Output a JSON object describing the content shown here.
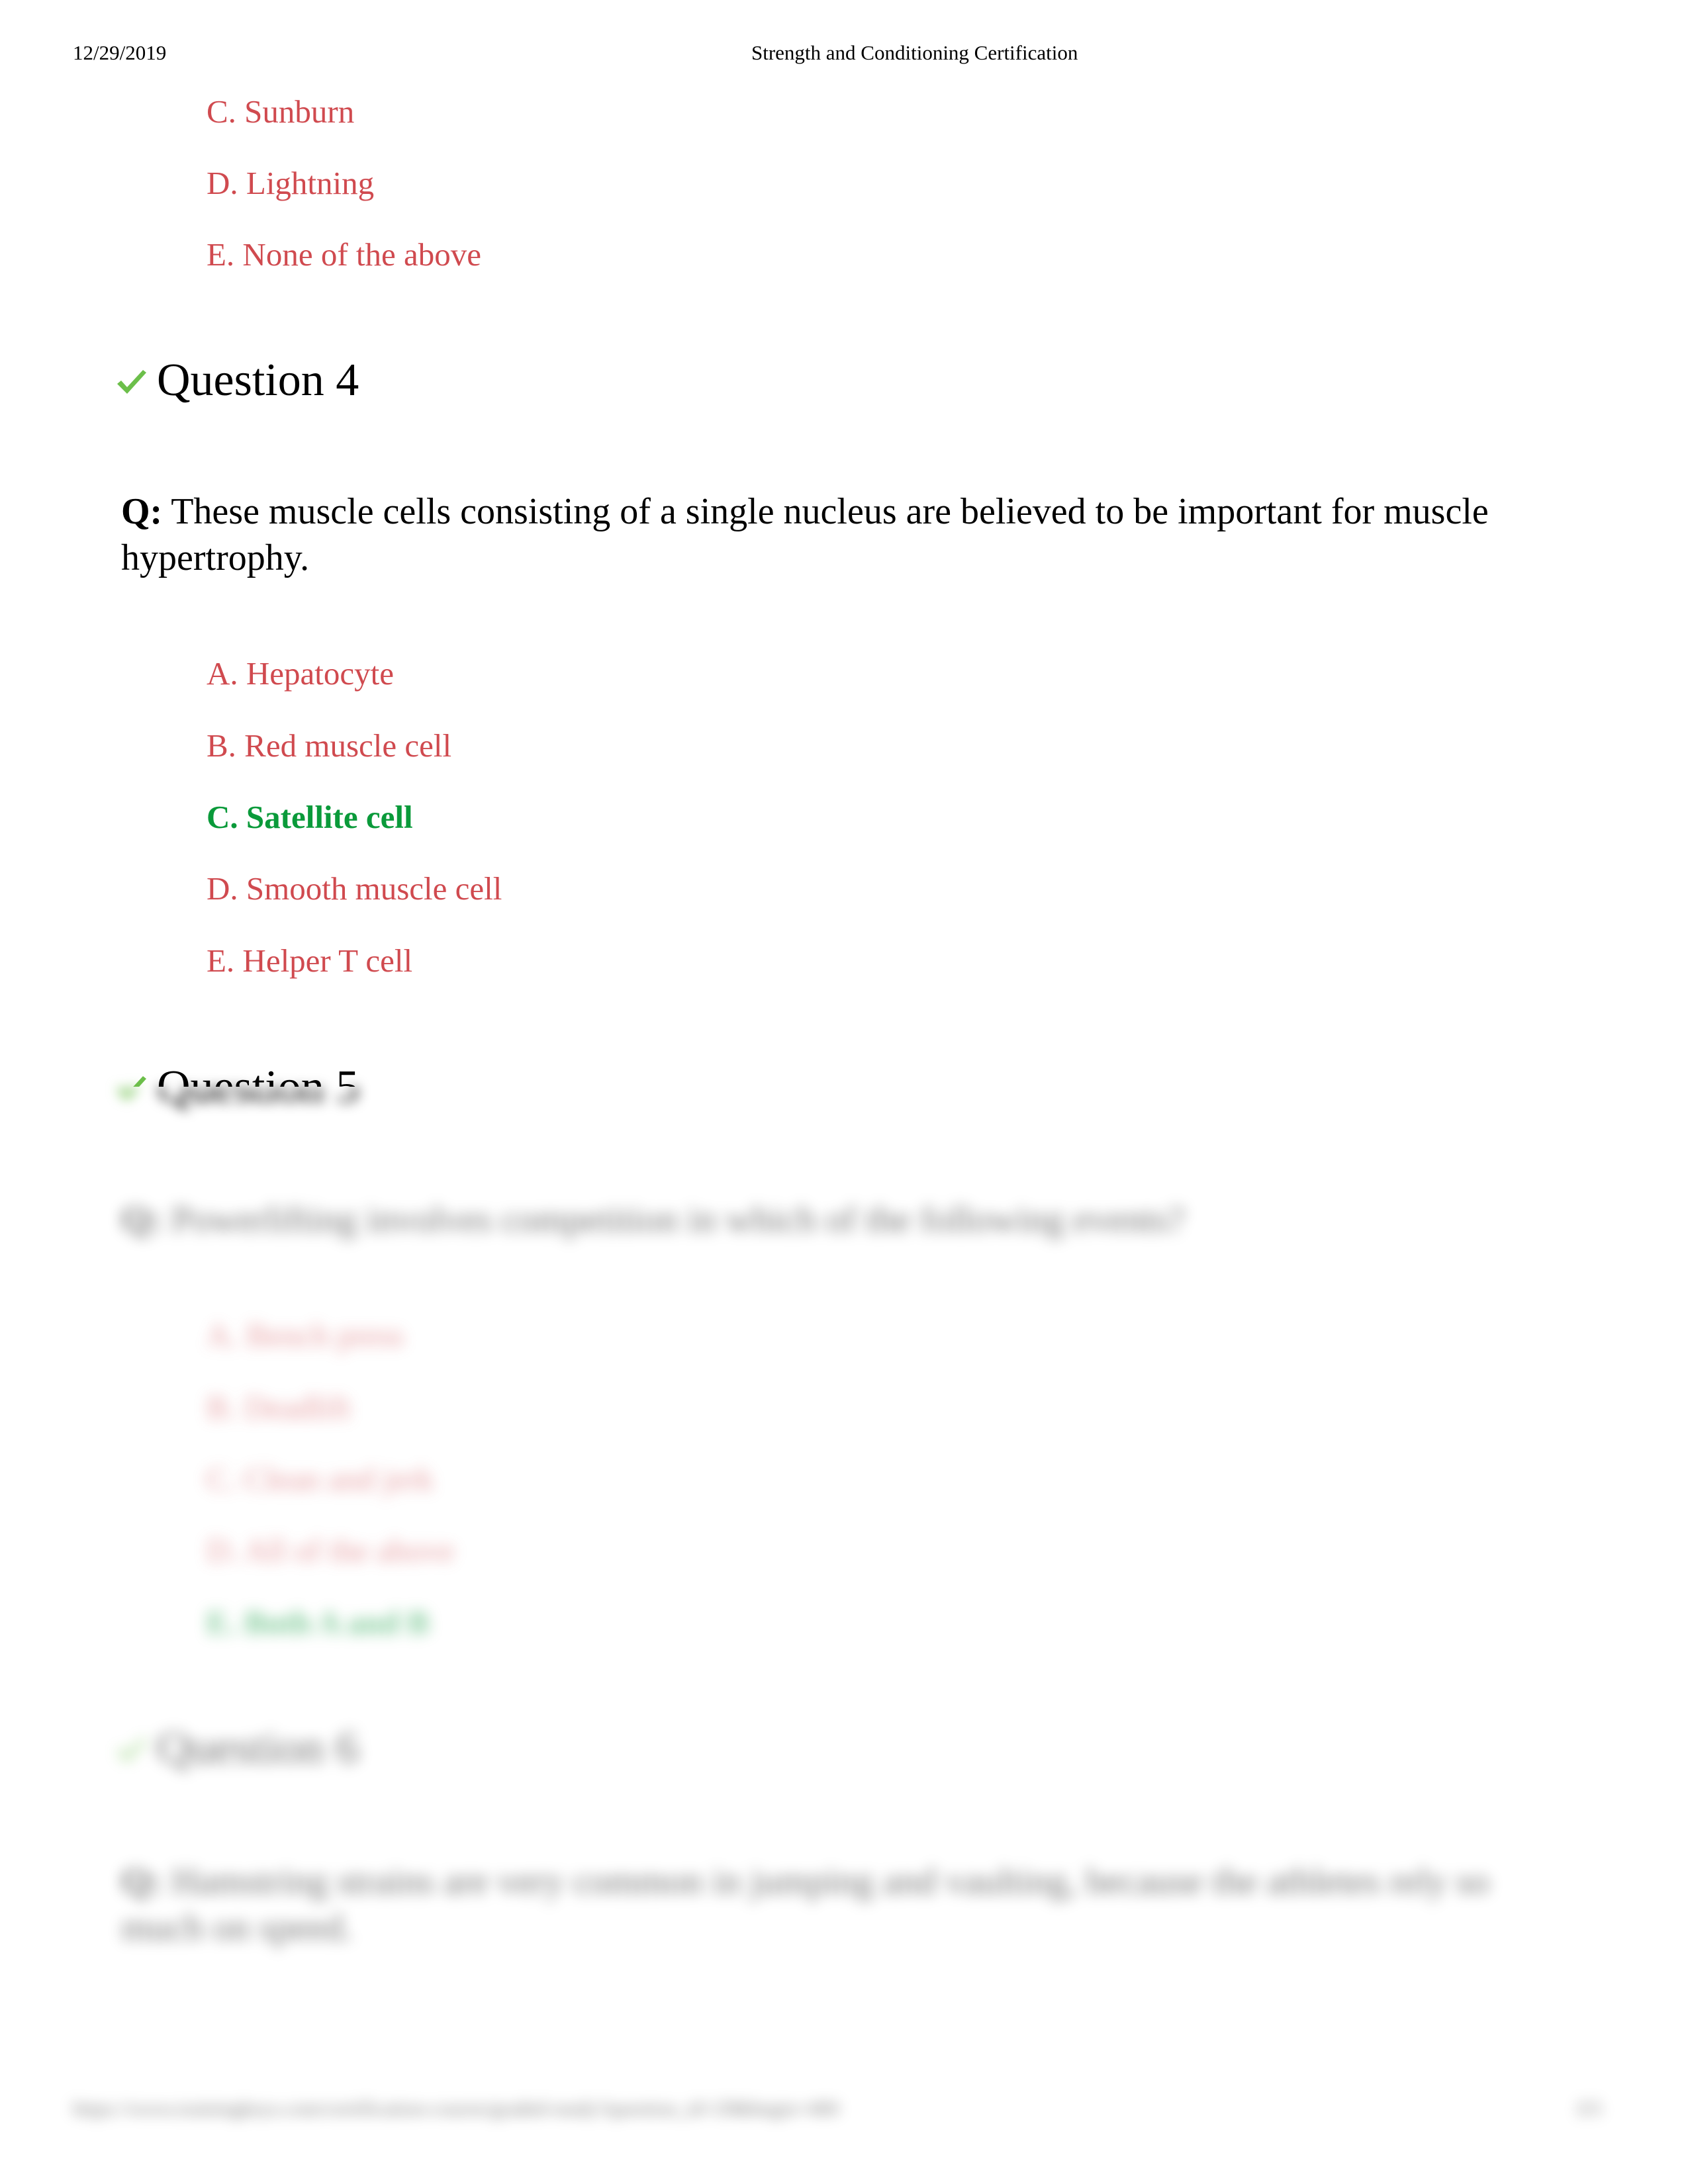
{
  "header": {
    "date": "12/29/2019",
    "title": "Strength and Conditioning Certification"
  },
  "colors": {
    "incorrect_option": "#d04a4f",
    "correct_option": "#0a9a3a",
    "check_icon": "#6cbf4a"
  },
  "question3_tail": {
    "options": [
      {
        "label": "C. Sunburn",
        "correct": false
      },
      {
        "label": "D. Lightning",
        "correct": false
      },
      {
        "label": "E. None of the above",
        "correct": false
      }
    ]
  },
  "question4": {
    "heading": "Question 4",
    "status_icon": "check-icon",
    "q_prefix": "Q:",
    "text": "These muscle cells consisting of a single nucleus are believed to be important for muscle hypertrophy.",
    "options": [
      {
        "label": "A. Hepatocyte",
        "correct": false
      },
      {
        "label": "B. Red muscle cell",
        "correct": false
      },
      {
        "label": "C. Satellite cell",
        "correct": true
      },
      {
        "label": "D. Smooth muscle cell",
        "correct": false
      },
      {
        "label": "E. Helper T cell",
        "correct": false
      }
    ]
  },
  "question5": {
    "heading": "Question 5",
    "status_icon": "check-icon",
    "q_prefix": "Q:",
    "text": "Powerlifting involves competition in which of the following events?",
    "options": [
      {
        "label": "A. Bench press",
        "correct": false
      },
      {
        "label": "B. Deadlift",
        "correct": false
      },
      {
        "label": "C. Clean and jerk",
        "correct": false
      },
      {
        "label": "D. All of the above",
        "correct": false
      },
      {
        "label": "E. Both A and B",
        "correct": true
      }
    ]
  },
  "question6": {
    "heading": "Question 6",
    "status_icon": "check-icon",
    "q_prefix": "Q:",
    "text": "Hamstring strains are very common in jumping and vaulting, because the athletes rely so much on speed."
  },
  "footer": {
    "url": "https://www.trainingkeys.com/certification-course/graded-study?question_id=29&begin=400",
    "page": "3/5"
  }
}
